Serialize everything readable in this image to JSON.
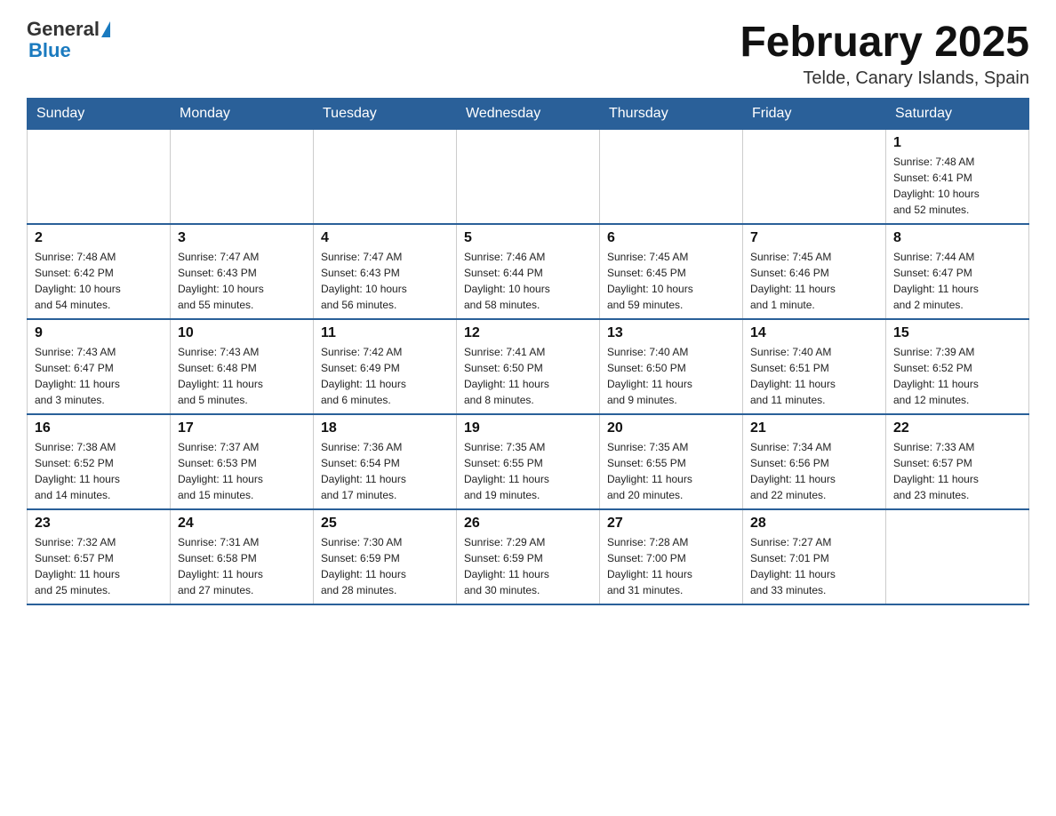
{
  "header": {
    "logo_general": "General",
    "logo_blue": "Blue",
    "title": "February 2025",
    "location": "Telde, Canary Islands, Spain"
  },
  "days_of_week": [
    "Sunday",
    "Monday",
    "Tuesday",
    "Wednesday",
    "Thursday",
    "Friday",
    "Saturday"
  ],
  "weeks": [
    [
      {
        "day": "",
        "info": ""
      },
      {
        "day": "",
        "info": ""
      },
      {
        "day": "",
        "info": ""
      },
      {
        "day": "",
        "info": ""
      },
      {
        "day": "",
        "info": ""
      },
      {
        "day": "",
        "info": ""
      },
      {
        "day": "1",
        "info": "Sunrise: 7:48 AM\nSunset: 6:41 PM\nDaylight: 10 hours\nand 52 minutes."
      }
    ],
    [
      {
        "day": "2",
        "info": "Sunrise: 7:48 AM\nSunset: 6:42 PM\nDaylight: 10 hours\nand 54 minutes."
      },
      {
        "day": "3",
        "info": "Sunrise: 7:47 AM\nSunset: 6:43 PM\nDaylight: 10 hours\nand 55 minutes."
      },
      {
        "day": "4",
        "info": "Sunrise: 7:47 AM\nSunset: 6:43 PM\nDaylight: 10 hours\nand 56 minutes."
      },
      {
        "day": "5",
        "info": "Sunrise: 7:46 AM\nSunset: 6:44 PM\nDaylight: 10 hours\nand 58 minutes."
      },
      {
        "day": "6",
        "info": "Sunrise: 7:45 AM\nSunset: 6:45 PM\nDaylight: 10 hours\nand 59 minutes."
      },
      {
        "day": "7",
        "info": "Sunrise: 7:45 AM\nSunset: 6:46 PM\nDaylight: 11 hours\nand 1 minute."
      },
      {
        "day": "8",
        "info": "Sunrise: 7:44 AM\nSunset: 6:47 PM\nDaylight: 11 hours\nand 2 minutes."
      }
    ],
    [
      {
        "day": "9",
        "info": "Sunrise: 7:43 AM\nSunset: 6:47 PM\nDaylight: 11 hours\nand 3 minutes."
      },
      {
        "day": "10",
        "info": "Sunrise: 7:43 AM\nSunset: 6:48 PM\nDaylight: 11 hours\nand 5 minutes."
      },
      {
        "day": "11",
        "info": "Sunrise: 7:42 AM\nSunset: 6:49 PM\nDaylight: 11 hours\nand 6 minutes."
      },
      {
        "day": "12",
        "info": "Sunrise: 7:41 AM\nSunset: 6:50 PM\nDaylight: 11 hours\nand 8 minutes."
      },
      {
        "day": "13",
        "info": "Sunrise: 7:40 AM\nSunset: 6:50 PM\nDaylight: 11 hours\nand 9 minutes."
      },
      {
        "day": "14",
        "info": "Sunrise: 7:40 AM\nSunset: 6:51 PM\nDaylight: 11 hours\nand 11 minutes."
      },
      {
        "day": "15",
        "info": "Sunrise: 7:39 AM\nSunset: 6:52 PM\nDaylight: 11 hours\nand 12 minutes."
      }
    ],
    [
      {
        "day": "16",
        "info": "Sunrise: 7:38 AM\nSunset: 6:52 PM\nDaylight: 11 hours\nand 14 minutes."
      },
      {
        "day": "17",
        "info": "Sunrise: 7:37 AM\nSunset: 6:53 PM\nDaylight: 11 hours\nand 15 minutes."
      },
      {
        "day": "18",
        "info": "Sunrise: 7:36 AM\nSunset: 6:54 PM\nDaylight: 11 hours\nand 17 minutes."
      },
      {
        "day": "19",
        "info": "Sunrise: 7:35 AM\nSunset: 6:55 PM\nDaylight: 11 hours\nand 19 minutes."
      },
      {
        "day": "20",
        "info": "Sunrise: 7:35 AM\nSunset: 6:55 PM\nDaylight: 11 hours\nand 20 minutes."
      },
      {
        "day": "21",
        "info": "Sunrise: 7:34 AM\nSunset: 6:56 PM\nDaylight: 11 hours\nand 22 minutes."
      },
      {
        "day": "22",
        "info": "Sunrise: 7:33 AM\nSunset: 6:57 PM\nDaylight: 11 hours\nand 23 minutes."
      }
    ],
    [
      {
        "day": "23",
        "info": "Sunrise: 7:32 AM\nSunset: 6:57 PM\nDaylight: 11 hours\nand 25 minutes."
      },
      {
        "day": "24",
        "info": "Sunrise: 7:31 AM\nSunset: 6:58 PM\nDaylight: 11 hours\nand 27 minutes."
      },
      {
        "day": "25",
        "info": "Sunrise: 7:30 AM\nSunset: 6:59 PM\nDaylight: 11 hours\nand 28 minutes."
      },
      {
        "day": "26",
        "info": "Sunrise: 7:29 AM\nSunset: 6:59 PM\nDaylight: 11 hours\nand 30 minutes."
      },
      {
        "day": "27",
        "info": "Sunrise: 7:28 AM\nSunset: 7:00 PM\nDaylight: 11 hours\nand 31 minutes."
      },
      {
        "day": "28",
        "info": "Sunrise: 7:27 AM\nSunset: 7:01 PM\nDaylight: 11 hours\nand 33 minutes."
      },
      {
        "day": "",
        "info": ""
      }
    ]
  ]
}
